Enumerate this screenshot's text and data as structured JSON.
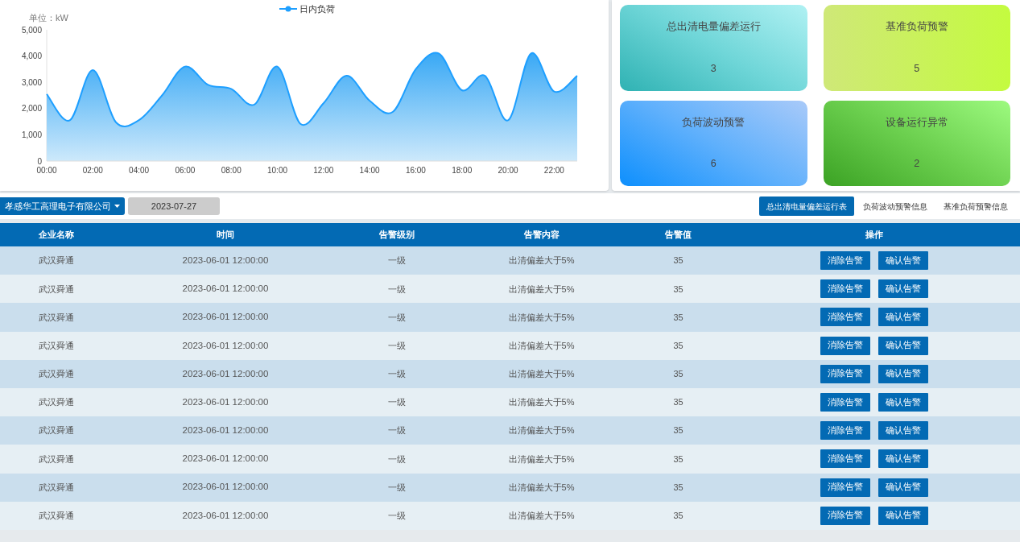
{
  "load_chart": {
    "unit": "单位：kW",
    "chart_data": {
      "type": "area",
      "x": [
        0,
        1,
        2,
        3,
        4,
        5,
        6,
        7,
        8,
        9,
        10,
        11,
        12,
        13,
        14,
        15,
        16,
        17,
        18,
        19,
        20,
        21,
        22,
        23
      ],
      "xlim": [
        0,
        23
      ],
      "xticks": [
        {
          "value": 0,
          "label": "00:00"
        },
        {
          "value": 2,
          "label": "02:00"
        },
        {
          "value": 4,
          "label": "04:00"
        },
        {
          "value": 6,
          "label": "06:00"
        },
        {
          "value": 8,
          "label": "08:00"
        },
        {
          "value": 10,
          "label": "10:00"
        },
        {
          "value": 12,
          "label": "12:00"
        },
        {
          "value": 14,
          "label": "14:00"
        },
        {
          "value": 16,
          "label": "16:00"
        },
        {
          "value": 18,
          "label": "18:00"
        },
        {
          "value": 20,
          "label": "20:00"
        },
        {
          "value": 22,
          "label": "22:00"
        }
      ],
      "series": [
        {
          "name": "日内负荷",
          "color": "#1e9fff",
          "values": [
            2550,
            1550,
            3470,
            1480,
            1560,
            2500,
            3600,
            2900,
            2750,
            2150,
            3600,
            1420,
            2200,
            3250,
            2300,
            1870,
            3500,
            4100,
            2700,
            3250,
            1550,
            4100,
            2650,
            3250
          ]
        }
      ],
      "ylim": [
        0,
        5000
      ],
      "yticks": [
        {
          "value": 0,
          "label": "0"
        },
        {
          "value": 1000,
          "label": "1,000"
        },
        {
          "value": 2000,
          "label": "2,000"
        },
        {
          "value": 3000,
          "label": "3,000"
        },
        {
          "value": 4000,
          "label": "4,000"
        },
        {
          "value": 5000,
          "label": "5,000"
        }
      ]
    }
  },
  "summary_cards": [
    {
      "title": "总出清电量偏差运行",
      "count": "3"
    },
    {
      "title": "基准负荷预警",
      "count": "5"
    },
    {
      "title": "负荷波动预警",
      "count": "6"
    },
    {
      "title": "设备运行异常",
      "count": "2"
    }
  ],
  "filters": {
    "company": "孝感华工高理电子有限公司",
    "date": "2023-07-27"
  },
  "tabs": [
    {
      "label": "总出清电量偏差运行表",
      "selected": true
    },
    {
      "label": "负荷波动预警信息",
      "selected": false
    },
    {
      "label": "基准负荷预警信息",
      "selected": false
    }
  ],
  "table": {
    "columns": [
      "企业名称",
      "时间",
      "告警级别",
      "告警内容",
      "告警值",
      "操作"
    ],
    "rows": [
      {
        "company": "武汉舜通",
        "time": "2023-06-01 12:00:00",
        "level": "一级",
        "content": "出清偏差大于5%",
        "value": "35",
        "actions": [
          "消除告警",
          "确认告警"
        ]
      },
      {
        "company": "武汉舜通",
        "time": "2023-06-01 12:00:00",
        "level": "一级",
        "content": "出清偏差大于5%",
        "value": "35",
        "actions": [
          "消除告警",
          "确认告警"
        ]
      },
      {
        "company": "武汉舜通",
        "time": "2023-06-01 12:00:00",
        "level": "一级",
        "content": "出清偏差大于5%",
        "value": "35",
        "actions": [
          "消除告警",
          "确认告警"
        ]
      },
      {
        "company": "武汉舜通",
        "time": "2023-06-01 12:00:00",
        "level": "一级",
        "content": "出清偏差大于5%",
        "value": "35",
        "actions": [
          "消除告警",
          "确认告警"
        ]
      },
      {
        "company": "武汉舜通",
        "time": "2023-06-01 12:00:00",
        "level": "一级",
        "content": "出清偏差大于5%",
        "value": "35",
        "actions": [
          "消除告警",
          "确认告警"
        ]
      },
      {
        "company": "武汉舜通",
        "time": "2023-06-01 12:00:00",
        "level": "一级",
        "content": "出清偏差大于5%",
        "value": "35",
        "actions": [
          "消除告警",
          "确认告警"
        ]
      },
      {
        "company": "武汉舜通",
        "time": "2023-06-01 12:00:00",
        "level": "一级",
        "content": "出清偏差大于5%",
        "value": "35",
        "actions": [
          "消除告警",
          "确认告警"
        ]
      },
      {
        "company": "武汉舜通",
        "time": "2023-06-01 12:00:00",
        "level": "一级",
        "content": "出清偏差大于5%",
        "value": "35",
        "actions": [
          "消除告警",
          "确认告警"
        ]
      },
      {
        "company": "武汉舜通",
        "time": "2023-06-01 12:00:00",
        "level": "一级",
        "content": "出清偏差大于5%",
        "value": "35",
        "actions": [
          "消除告警",
          "确认告警"
        ]
      },
      {
        "company": "武汉舜通",
        "time": "2023-06-01 12:00:00",
        "level": "一级",
        "content": "出清偏差大于5%",
        "value": "35",
        "actions": [
          "消除告警",
          "确认告警"
        ]
      }
    ]
  }
}
